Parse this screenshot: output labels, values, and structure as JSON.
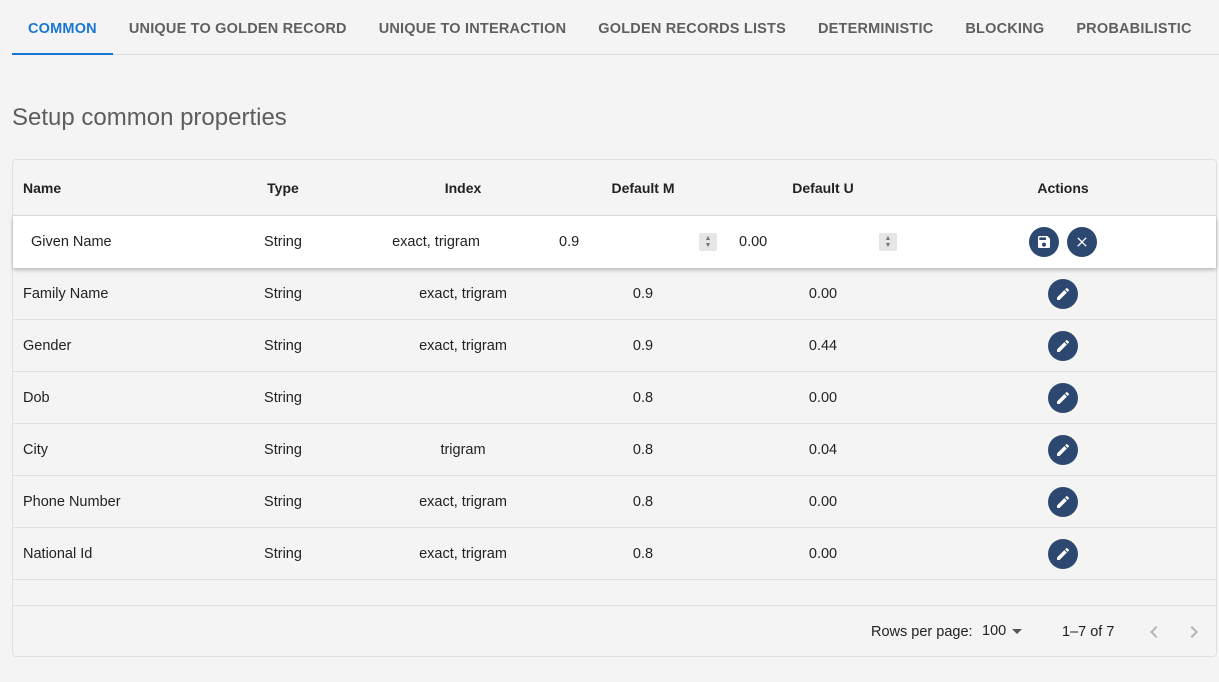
{
  "tabs": [
    {
      "label": "COMMON",
      "active": true
    },
    {
      "label": "UNIQUE TO GOLDEN RECORD"
    },
    {
      "label": "UNIQUE TO INTERACTION"
    },
    {
      "label": "GOLDEN RECORDS LISTS"
    },
    {
      "label": "DETERMINISTIC"
    },
    {
      "label": "BLOCKING"
    },
    {
      "label": "PROBABILISTIC"
    }
  ],
  "page_title": "Setup common properties",
  "table": {
    "headers": {
      "name": "Name",
      "type": "Type",
      "index": "Index",
      "default_m": "Default M",
      "default_u": "Default U",
      "actions": "Actions"
    },
    "editing_row": {
      "name": "Given Name",
      "type": "String",
      "index": "exact, trigram",
      "default_m": "0.9",
      "default_u": "0.00"
    },
    "rows": [
      {
        "name": "Family Name",
        "type": "String",
        "index": "exact, trigram",
        "default_m": "0.9",
        "default_u": "0.00"
      },
      {
        "name": "Gender",
        "type": "String",
        "index": "exact, trigram",
        "default_m": "0.9",
        "default_u": "0.44"
      },
      {
        "name": "Dob",
        "type": "String",
        "index": "",
        "default_m": "0.8",
        "default_u": "0.00"
      },
      {
        "name": "City",
        "type": "String",
        "index": "trigram",
        "default_m": "0.8",
        "default_u": "0.04"
      },
      {
        "name": "Phone Number",
        "type": "String",
        "index": "exact, trigram",
        "default_m": "0.8",
        "default_u": "0.00"
      },
      {
        "name": "National Id",
        "type": "String",
        "index": "exact, trigram",
        "default_m": "0.8",
        "default_u": "0.00"
      }
    ]
  },
  "pagination": {
    "rows_per_page_label": "Rows per page:",
    "rows_per_page": "100",
    "range": "1–7 of 7"
  },
  "colors": {
    "accent": "#1976d2",
    "action_button": "#2d4870"
  },
  "icons": {
    "save": "save-icon",
    "cancel": "close-icon",
    "edit": "edit-icon",
    "prev": "chevron-left-icon",
    "next": "chevron-right-icon",
    "dropdown": "caret-down-icon"
  }
}
